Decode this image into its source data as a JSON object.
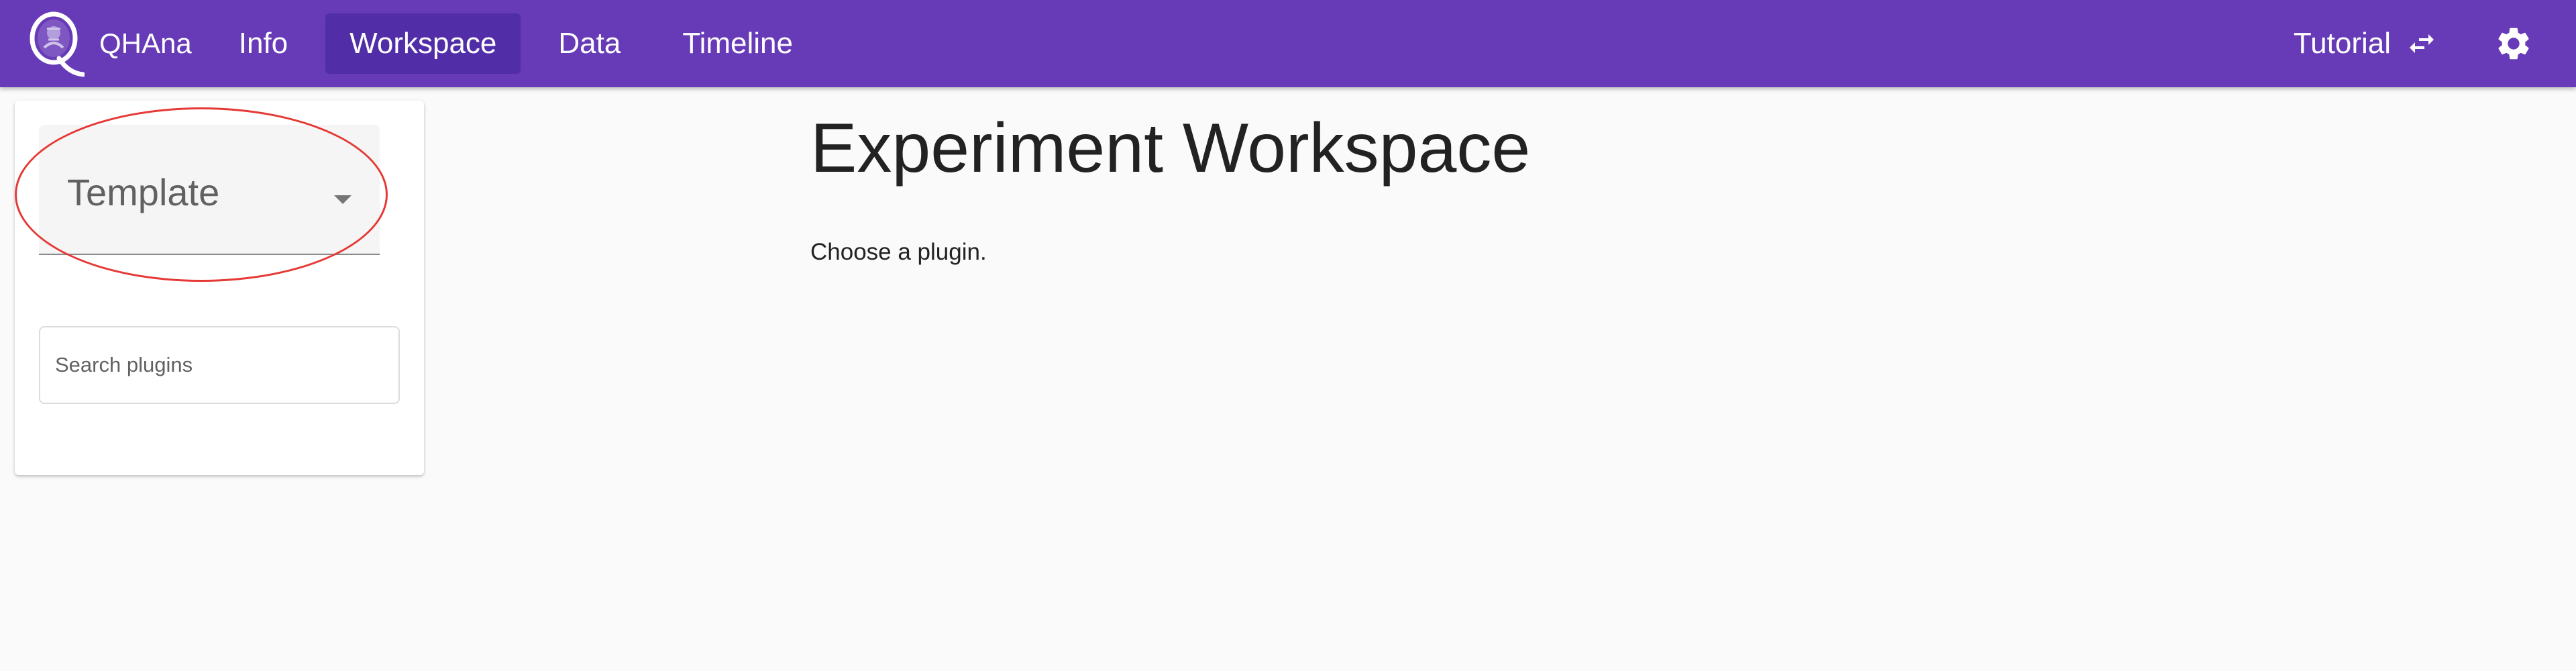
{
  "app": {
    "brand": "QHAna"
  },
  "nav": {
    "items": [
      {
        "label": "Info"
      },
      {
        "label": "Workspace"
      },
      {
        "label": "Data"
      },
      {
        "label": "Timeline"
      }
    ],
    "active_index": 1
  },
  "toolbar": {
    "tutorial_label": "Tutorial",
    "tutorial_icon": "swap-horiz-icon",
    "settings_icon": "gear-icon"
  },
  "sidebar": {
    "template_select": {
      "value": "Template",
      "icon": "chevron-down-icon"
    },
    "search": {
      "placeholder": "Search plugins",
      "value": ""
    }
  },
  "main": {
    "title": "Experiment Workspace",
    "message": "Choose a plugin."
  },
  "colors": {
    "primary": "#673ab7",
    "primary_dark": "#512da8",
    "highlight": "#e53935",
    "background": "#fafafa"
  }
}
